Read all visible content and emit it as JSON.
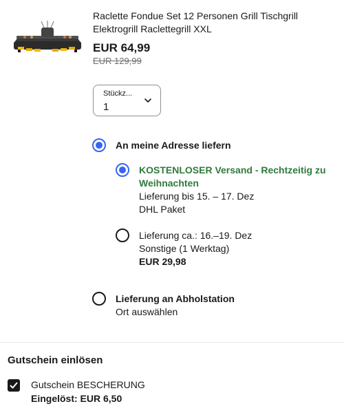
{
  "item": {
    "title": "Raclette Fondue Set 12 Personen Grill Tischgrill Elektrogrill Raclettegrill XXL",
    "price": "EUR 64,99",
    "old_price": "EUR 129,99",
    "image_icon": "raclette-grill-product-image"
  },
  "quantity": {
    "label": "Stückz...",
    "value": "1",
    "icon": "chevron-down-icon"
  },
  "delivery": {
    "address_option": {
      "label": "An meine Adresse liefern",
      "selected": true
    },
    "shipping_options": [
      {
        "title": "KOSTENLOSER Versand - Rechtzeitig zu Weihnachten",
        "line2": "Lieferung bis 15. – 17. Dez",
        "line3": "DHL Paket",
        "selected": true
      },
      {
        "title": "Lieferung ca.: 16.–19. Dez",
        "line2": "Sonstige (1 Werktag)",
        "line3": "EUR 29,98",
        "selected": false
      }
    ],
    "pickup_option": {
      "label": "Lieferung an Abholstation",
      "sublabel": "Ort auswählen",
      "selected": false
    }
  },
  "voucher": {
    "title": "Gutschein einlösen",
    "name": "Gutschein BESCHERUNG",
    "applied": "Eingelöst: EUR 6,50",
    "checked": true
  },
  "colors": {
    "accent_blue": "#3665f3",
    "free_shipping_green": "#2f7a3c",
    "text": "#191919",
    "strikethrough_gray": "#707070"
  }
}
